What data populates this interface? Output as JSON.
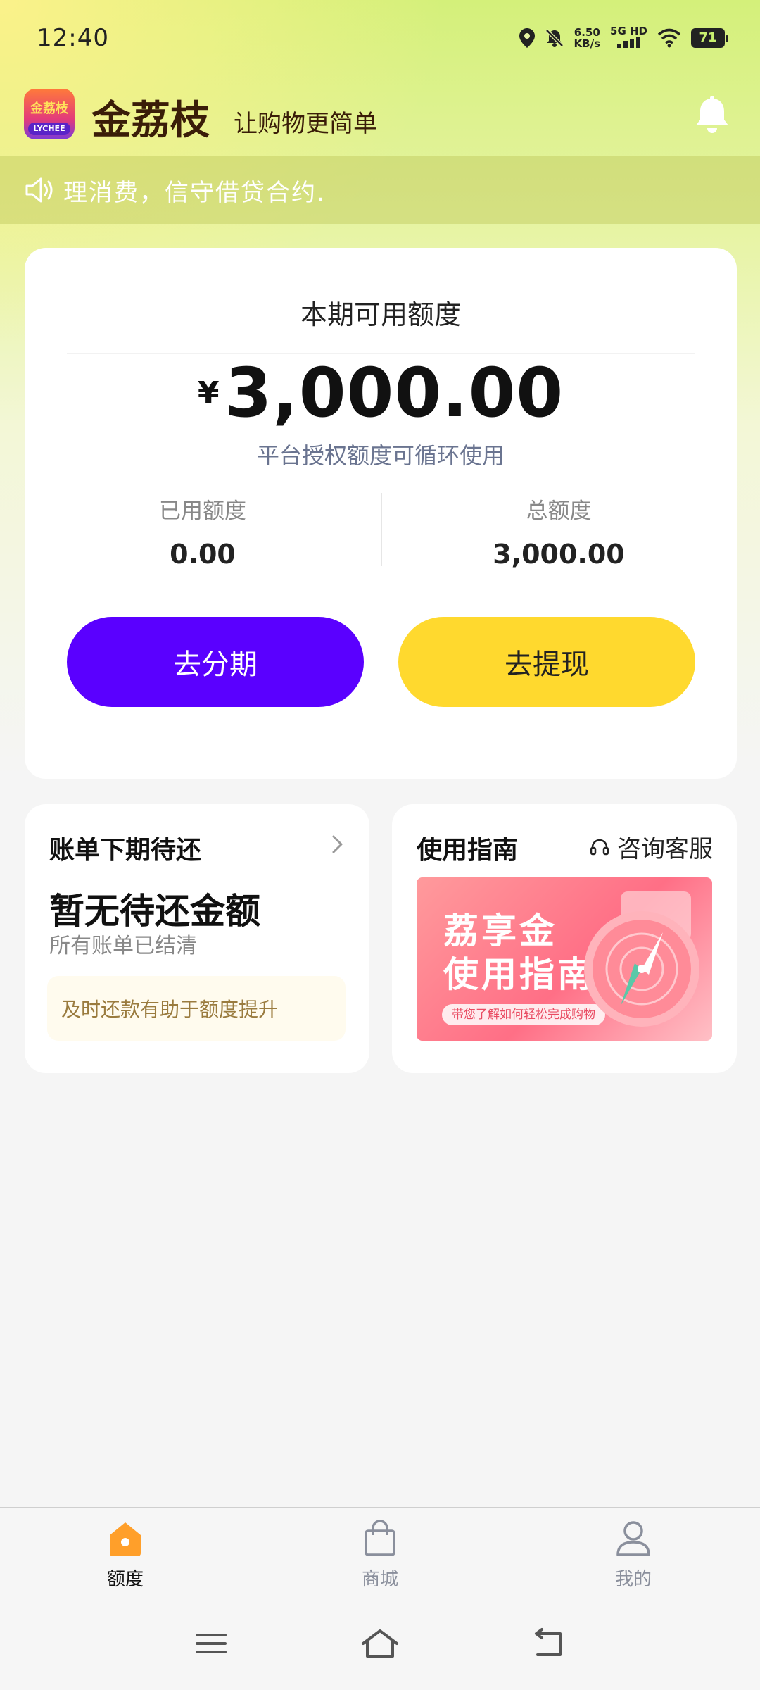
{
  "status_bar": {
    "time": "12:40",
    "net_speed_value": "6.50",
    "net_speed_unit": "KB/s",
    "network_type": "5G HD",
    "battery": "71"
  },
  "header": {
    "logo_text_top": "金荔枝",
    "logo_text_bottom": "LYCHEE",
    "app_name": "金荔枝",
    "slogan": "让购物更简单"
  },
  "notice": {
    "text": "理消费，信守借贷合约."
  },
  "credit_card": {
    "title": "本期可用额度",
    "currency_symbol": "¥",
    "available_amount": "3,000.00",
    "subtitle": "平台授权额度可循环使用",
    "used_label": "已用额度",
    "used_value": "0.00",
    "total_label": "总额度",
    "total_value": "3,000.00",
    "installment_button": "去分期",
    "withdraw_button": "去提现"
  },
  "bill_card": {
    "title": "账单下期待还",
    "status": "暂无待还金额",
    "status_sub": "所有账单已结清",
    "tip": "及时还款有助于额度提升"
  },
  "guide_card": {
    "title": "使用指南",
    "service_label": "咨询客服",
    "banner_title_line1": "荔享金",
    "banner_title_line2": "使用指南",
    "banner_pill": "带您了解如何轻松完成购物"
  },
  "bottom_nav": {
    "items": [
      {
        "label": "额度",
        "icon": "home-icon",
        "active": true
      },
      {
        "label": "商城",
        "icon": "shopping-bag-icon",
        "active": false
      },
      {
        "label": "我的",
        "icon": "user-icon",
        "active": false
      }
    ]
  },
  "colors": {
    "primary_purple": "#5a00ff",
    "accent_yellow": "#ffd92e",
    "active_nav_orange": "#ff9f2a",
    "brand_brown": "#3a1d08"
  }
}
